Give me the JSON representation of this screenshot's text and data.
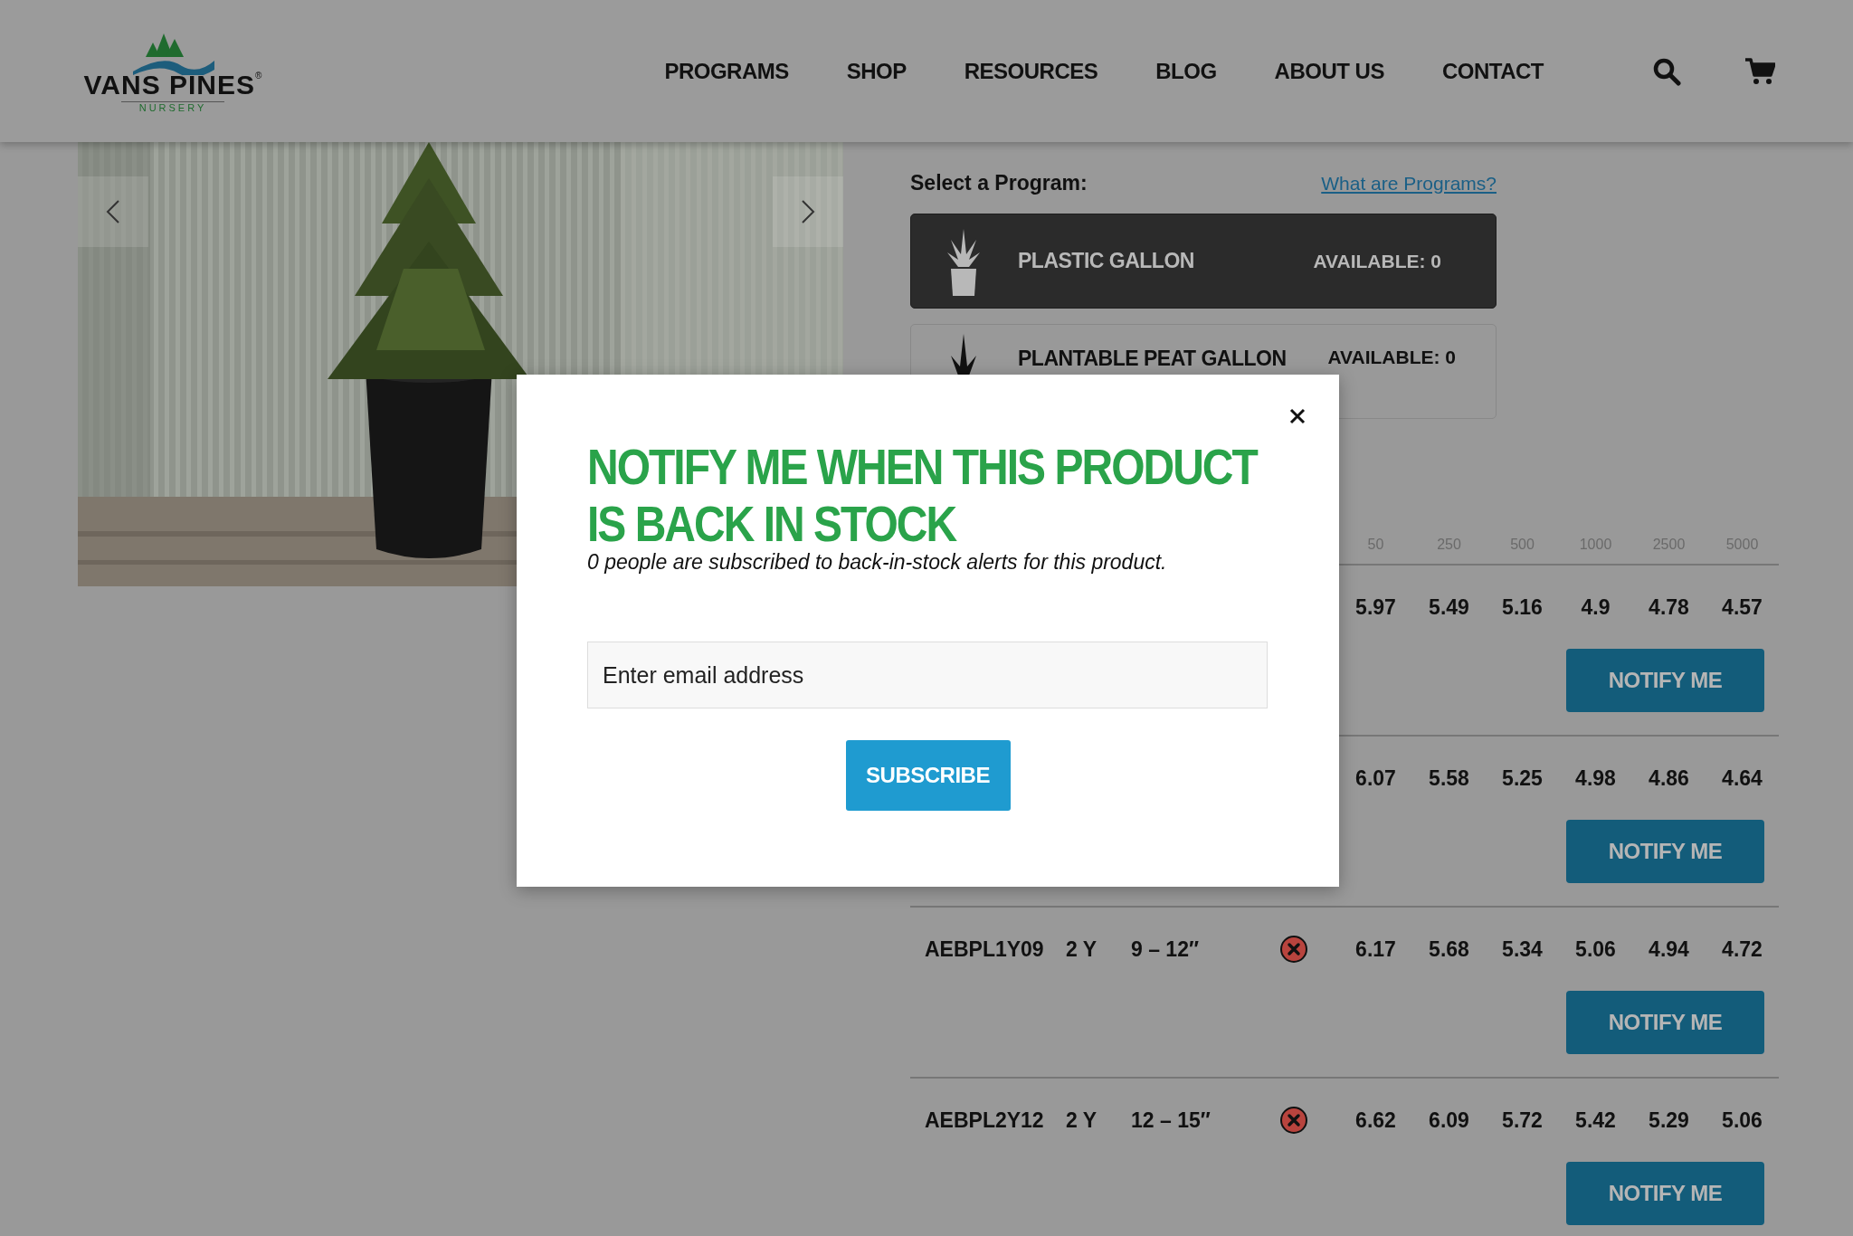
{
  "header": {
    "logo": {
      "name": "VANS PINES",
      "registered": "®",
      "tagline": "NURSERY"
    },
    "nav": [
      "PROGRAMS",
      "SHOP",
      "RESOURCES",
      "BLOG",
      "ABOUT US",
      "CONTACT"
    ]
  },
  "program_picker": {
    "label": "Select a Program:",
    "help_link": "What are Programs?",
    "programs": [
      {
        "kind": "pot",
        "name": "PLASTIC GALLON",
        "availability": "AVAILABLE: 0",
        "selected": true
      },
      {
        "kind": "peat",
        "name": "PLANTABLE PEAT GALLON",
        "availability": "AVAILABLE: 0",
        "selected": false
      }
    ]
  },
  "pricing_table": {
    "quantity_columns": [
      "50",
      "250",
      "500",
      "1000",
      "2500",
      "5000"
    ],
    "rows": [
      {
        "prices": [
          "5.97",
          "5.49",
          "5.16",
          "4.9",
          "4.78",
          "4.57"
        ],
        "button": "NOTIFY ME"
      },
      {
        "prices": [
          "6.07",
          "5.58",
          "5.25",
          "4.98",
          "4.86",
          "4.64"
        ],
        "button": "NOTIFY ME"
      },
      {
        "code": "AEBPL1Y09",
        "age": "2 Y",
        "size": "9 – 12″",
        "in_stock": false,
        "prices": [
          "6.17",
          "5.68",
          "5.34",
          "5.06",
          "4.94",
          "4.72"
        ],
        "button": "NOTIFY ME"
      },
      {
        "code": "AEBPL2Y12",
        "age": "2 Y",
        "size": "12 – 15″",
        "in_stock": false,
        "prices": [
          "6.62",
          "6.09",
          "5.72",
          "5.42",
          "5.29",
          "5.06"
        ],
        "button": "NOTIFY ME"
      }
    ]
  },
  "modal": {
    "title": "NOTIFY ME WHEN THIS PRODUCT IS BACK IN STOCK",
    "subtitle": "0 people are subscribed to back-in-stock alerts for this product.",
    "email": {
      "placeholder": "Enter email address"
    },
    "submit": "SUBSCRIBE"
  }
}
